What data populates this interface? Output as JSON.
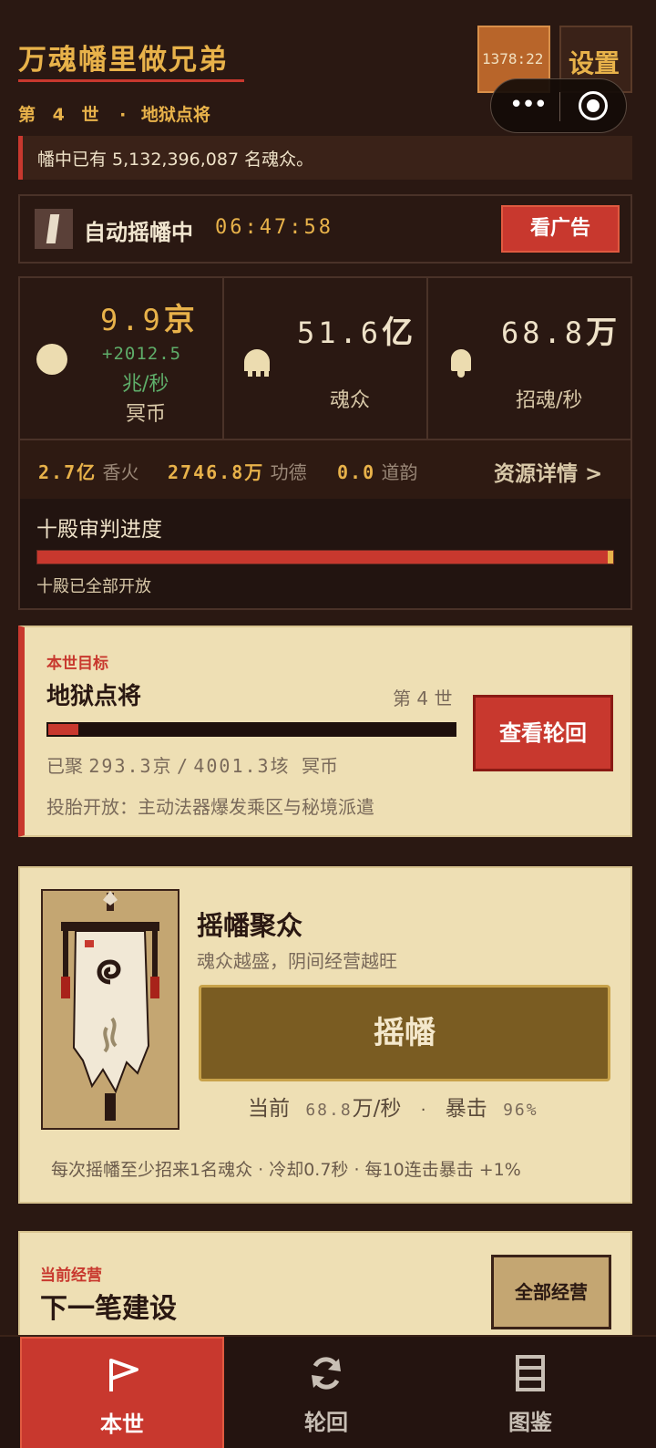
{
  "header": {
    "title": "万魂幡里做兄弟",
    "generation_label": "第 4 世",
    "separator": "·",
    "stage_name": "地狱点将",
    "timer_text": "1378:22",
    "settings_label": "设置"
  },
  "notice": {
    "text": "幡中已有 5,132,396,087 名魂众。"
  },
  "auto": {
    "label": "自动摇幡中",
    "time": "06:47:58",
    "ad_button": "看广告"
  },
  "stats": {
    "currency": {
      "value": "9.9",
      "unit": "京",
      "rate": "+2012.5",
      "rate_unit": "兆/秒",
      "label": "冥币",
      "icon": "coin-icon"
    },
    "souls": {
      "value": "51.6",
      "unit": "亿",
      "label": "魂众",
      "icon": "ghost-icon"
    },
    "summon": {
      "value": "68.8",
      "unit": "万",
      "label": "招魂/秒",
      "icon": "bell-icon"
    }
  },
  "resources": {
    "incense": {
      "value": "2.7",
      "unit": "亿",
      "label": "香火"
    },
    "merit": {
      "value": "2746.8",
      "unit": "万",
      "label": "功德"
    },
    "dao": {
      "value": "0.0",
      "label": "道韵"
    },
    "detail_label": "资源详情 >"
  },
  "judgement": {
    "title": "十殿审判进度",
    "progress": 1.0,
    "note": "十殿已全部开放"
  },
  "goal": {
    "tag": "本世目标",
    "name": "地狱点将",
    "generation": "第 4 世",
    "progress": 0.073,
    "progress_prefix": "已聚",
    "current": "293.3",
    "current_unit": "京",
    "slash": "/",
    "target": "4001.3",
    "target_unit": "垓",
    "currency": "冥币",
    "unlock": "投胎开放：主动法器爆发乘区与秘境派遣",
    "button": "查看轮回"
  },
  "banner": {
    "title": "摇幡聚众",
    "desc": "魂众越盛，阴间经营越旺",
    "button": "摇幡",
    "current_label": "当前",
    "current_value": "68.8",
    "current_unit": "万/秒",
    "dot": "·",
    "crit_label": "暴击",
    "crit_value": "96%",
    "note": "每次摇幡至少招来1名魂众 · 冷却0.7秒 · 每10连击暴击 +1%"
  },
  "manage": {
    "tag": "当前经营",
    "name": "下一笔建设",
    "button": "全部经营"
  },
  "tabs": [
    {
      "label": "本世",
      "icon": "flag-icon",
      "active": true
    },
    {
      "label": "轮回",
      "icon": "refresh-icon",
      "active": false
    },
    {
      "label": "图鉴",
      "icon": "book-icon",
      "active": false
    }
  ],
  "colors": {
    "background": "#2a1812",
    "accent_red": "#c8382e",
    "gold": "#e8b24a",
    "card": "#eedfb4",
    "positive_green": "#5fae6a"
  }
}
